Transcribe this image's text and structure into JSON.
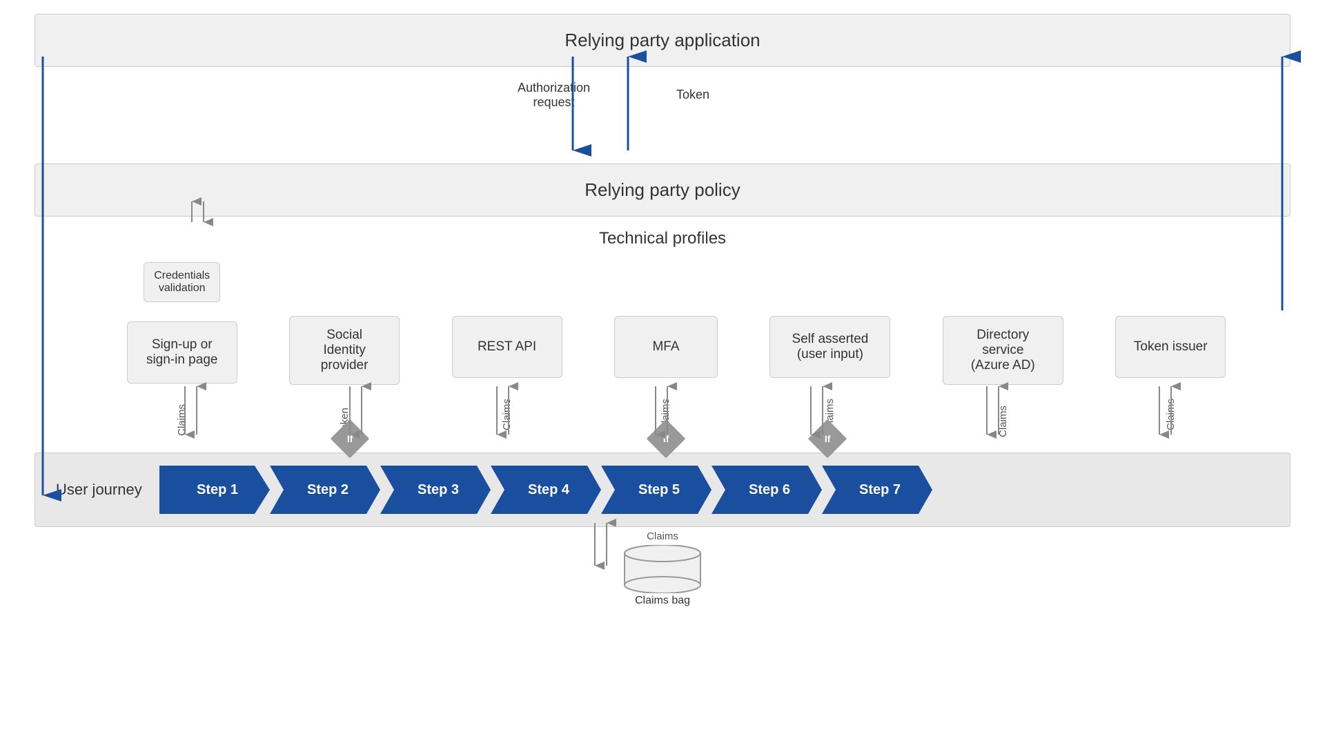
{
  "diagram": {
    "rp_application": {
      "label": "Relying party application"
    },
    "auth_request": {
      "label": "Authorization\nrequest"
    },
    "token_label": {
      "label": "Token"
    },
    "rp_policy": {
      "label": "Relying party policy"
    },
    "tech_profiles": {
      "section_label": "Technical profiles",
      "boxes": [
        {
          "id": "sign-up-sign-in",
          "label": "Sign-up or\nsign-in page",
          "has_credentials": true,
          "credentials_label": "Credentials\nvalidation"
        },
        {
          "id": "social-identity",
          "label": "Social\nIdentity\nprovider",
          "has_credentials": false
        },
        {
          "id": "rest-api",
          "label": "REST API",
          "has_credentials": false
        },
        {
          "id": "mfa",
          "label": "MFA",
          "has_credentials": false
        },
        {
          "id": "self-asserted",
          "label": "Self asserted\n(user input)",
          "has_credentials": false
        },
        {
          "id": "directory-service",
          "label": "Directory\nservice\n(Azure AD)",
          "has_credentials": false
        },
        {
          "id": "token-issuer",
          "label": "Token issuer",
          "has_credentials": false
        }
      ],
      "claims_labels": [
        "Claims",
        "Token",
        "Claims",
        "Claims",
        "Claims",
        "Claims",
        "Claims"
      ]
    },
    "user_journey": {
      "label": "User journey",
      "steps": [
        "Step 1",
        "Step 2",
        "Step 3",
        "Step 4",
        "Step 5",
        "Step 6",
        "Step 7"
      ],
      "if_positions": [
        1,
        3,
        4
      ]
    },
    "claims_bag": {
      "label": "Claims bag",
      "claims_label": "Claims"
    },
    "colors": {
      "blue_arrow": "#1a4fa0",
      "blue_dark": "#1a4fa0",
      "gray_box": "#f0f0f0",
      "gray_border": "#ccc",
      "gray_arrow": "#888",
      "step_bg": "#1e4d9e"
    }
  }
}
